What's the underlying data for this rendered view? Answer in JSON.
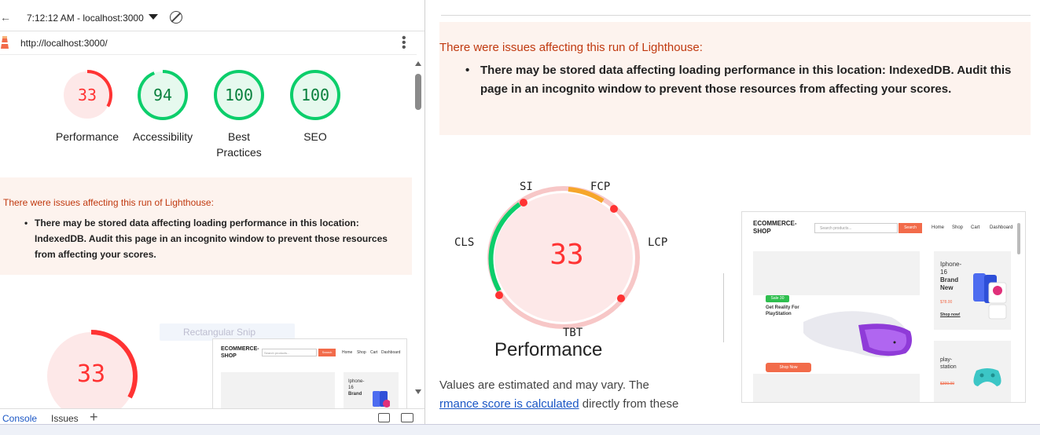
{
  "topbar": {
    "time": "7:12:12 AM - localhost:3000",
    "back_icon": "arrow-left-icon",
    "caret_icon": "caret-down-icon",
    "block_icon": "block-icon"
  },
  "urlbar": {
    "url": "http://localhost:3000/",
    "logo_icon": "lighthouse-icon",
    "menu_icon": "kebab-icon"
  },
  "gauges": [
    {
      "score": "33",
      "label": "Performance",
      "color": "#ff3333",
      "fraction": 0.33
    },
    {
      "score": "94",
      "label": "Accessibility",
      "color": "#0cce6b",
      "fraction": 0.94
    },
    {
      "score": "100",
      "label": "Best Practices",
      "color": "#0cce6b",
      "fraction": 1.0
    },
    {
      "score": "100",
      "label": "SEO",
      "color": "#0cce6b",
      "fraction": 1.0
    }
  ],
  "warning": {
    "title": "There were issues affecting this run of Lighthouse:",
    "item": "There may be stored data affecting loading performance in this location: IndexedDB. Audit this page in an incognito window to prevent those resources from affecting your scores."
  },
  "warning_right": {
    "title": "There were issues affecting this run of Lighthouse:",
    "item": "There may be stored data affecting loading performance in this location: IndexedDB. Audit this page in an incognito window to prevent those resources from affecting your scores."
  },
  "ghost": {
    "label": "Rectangular Snip"
  },
  "perf": {
    "score": "33",
    "title": "Performance",
    "metrics": {
      "si": "SI",
      "fcp": "FCP",
      "lcp": "LCP",
      "tbt": "TBT",
      "cls": "CLS"
    },
    "estimate_text": "Values are estimated and may vary. The",
    "link_text": "rmance score is calculated",
    "estimate_tail": " directly from these"
  },
  "drawer": {
    "console": "Console",
    "issues": "Issues",
    "add": "+"
  },
  "eshop": {
    "logo_line1": "ECOMMERCE-",
    "logo_line2": "SHOP",
    "search_placeholder": "Search products...",
    "search_button": "Search",
    "nav": [
      "Home",
      "Shop",
      "Cart",
      "Dashboard"
    ],
    "sale_badge": "Sale 30",
    "hero_title_line1": "Get Reality For",
    "hero_title_line2": "PlayStation",
    "shop_now": "Shop Now",
    "card1_line1": "Iphone-",
    "card1_line2": "16",
    "card1_line3": "Brand",
    "card1_line4": "New",
    "card1_price": "$78.00",
    "card1_link": "Shop now!",
    "card2_line1": "play-",
    "card2_line2": "station",
    "card2_price": "$399.00"
  }
}
